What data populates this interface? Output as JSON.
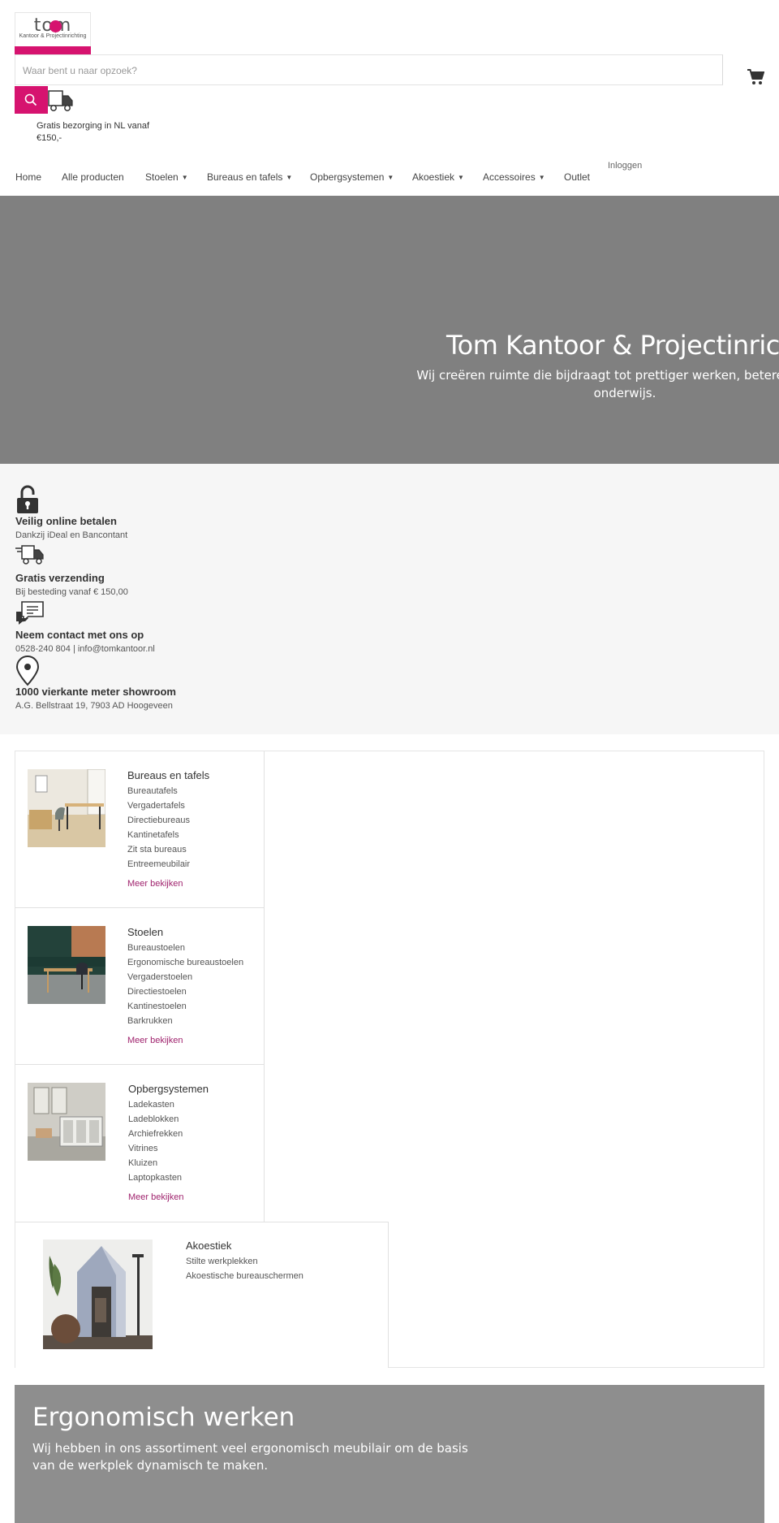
{
  "brand": {
    "logo_word": "tom",
    "logo_sub": "Kantoor & Projectinrichting",
    "accent": "#d6136f"
  },
  "search": {
    "placeholder": "Waar bent u naar opzoek?"
  },
  "shipping_note": "Gratis bezorging in NL vanaf €150,-",
  "nav": {
    "items": [
      {
        "label": "Home"
      },
      {
        "label": "Alle producten"
      },
      {
        "label": "Stoelen",
        "dropdown": true
      },
      {
        "label": "Bureaus en tafels",
        "dropdown": true
      },
      {
        "label": "Opbergsystemen",
        "dropdown": true
      },
      {
        "label": "Akoestiek",
        "dropdown": true
      },
      {
        "label": "Accessoires",
        "dropdown": true
      },
      {
        "label": "Outlet"
      }
    ],
    "login": "Inloggen"
  },
  "hero": {
    "title": "Tom Kantoor & Projectinrichting",
    "subtitle": "Wij creëren ruimte die bijdraagt tot prettiger werken, betere zorg en onderwijs."
  },
  "features": [
    {
      "icon": "lock-icon",
      "title": "Veilig online betalen",
      "text": "Dankzij iDeal en Bancontant"
    },
    {
      "icon": "truck-icon",
      "title": "Gratis verzending",
      "text": "Bij besteding vanaf € 150,00"
    },
    {
      "icon": "chat-icon",
      "title": "Neem contact met ons op",
      "text": "0528-240 804 | info@tomkantoor.nl"
    },
    {
      "icon": "map-pin-icon",
      "title": "1000 vierkante meter showroom",
      "text": "A.G. Bellstraat 19, 7903 AD Hoogeveen"
    }
  ],
  "collections": [
    {
      "title": "Bureaus en tafels",
      "links": [
        "Bureautafels",
        "Vergadertafels",
        "Directiebureaus",
        "Kantinetafels",
        "Zit sta bureaus",
        "Entreemeubilair"
      ],
      "more": "Meer bekijken"
    },
    {
      "title": "Stoelen",
      "links": [
        "Bureaustoelen",
        "Ergonomische bureaustoelen",
        "Vergaderstoelen",
        "Directiestoelen",
        "Kantinestoelen",
        "Barkrukken"
      ],
      "more": "Meer bekijken"
    },
    {
      "title": "Opbergsystemen",
      "links": [
        "Ladekasten",
        "Ladeblokken",
        "Archiefrekken",
        "Vitrines",
        "Kluizen",
        "Laptopkasten"
      ],
      "more": "Meer bekijken"
    },
    {
      "title": "Akoestiek",
      "links": [
        "Stilte werkplekken",
        "Akoestische bureauschermen"
      ]
    }
  ],
  "banner": {
    "title": "Ergonomisch werken",
    "text": "Wij hebben in ons assortiment veel ergonomisch meubilair om de basis van de werkplek dynamisch te maken."
  }
}
